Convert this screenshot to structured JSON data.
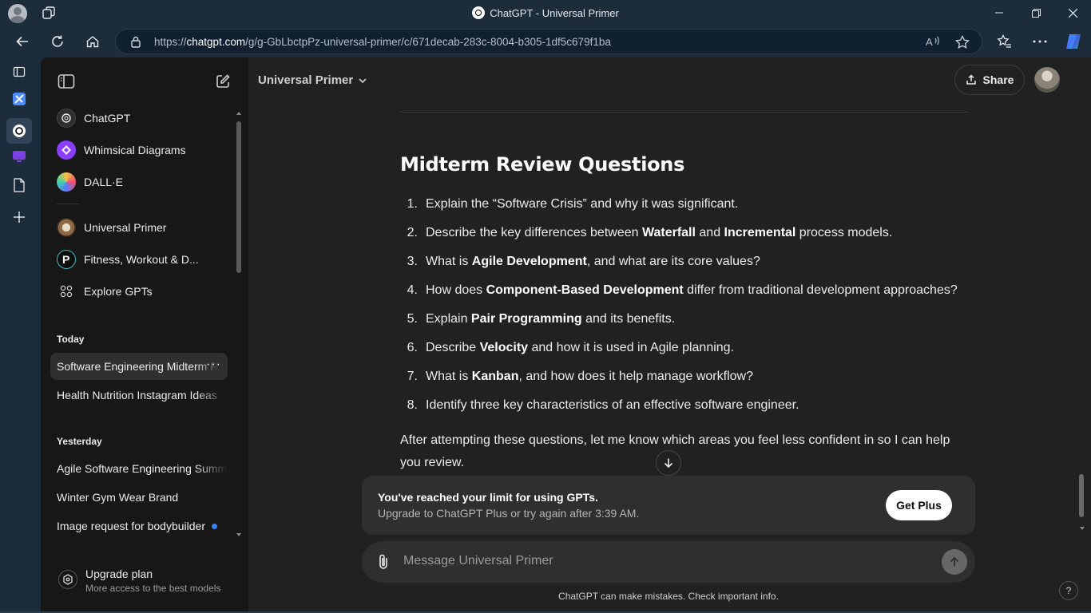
{
  "browser": {
    "window_title": "ChatGPT - Universal Primer",
    "url_prefix": "https://",
    "url_host": "chatgpt.com",
    "url_path": "/g/g-GbLbctpPz-universal-primer/c/671decab-283c-8004-b305-1df5c679f1ba",
    "read_aloud_label": "A⁾"
  },
  "sidebar": {
    "gpts": [
      {
        "label": "ChatGPT",
        "icon": "chatgpt-logo-icon"
      },
      {
        "label": "Whimsical Diagrams",
        "icon": "whimsical-icon"
      },
      {
        "label": "DALL·E",
        "icon": "dalle-icon"
      },
      {
        "label": "Universal Primer",
        "icon": "universal-primer-icon"
      },
      {
        "label": "Fitness, Workout & D...",
        "icon": "fitness-gpt-icon"
      },
      {
        "label": "Explore GPTs",
        "icon": "grid-icon"
      }
    ],
    "today_label": "Today",
    "today": [
      {
        "label": "Software Engineering Midterm Review"
      },
      {
        "label": "Health Nutrition Instagram Ideas"
      }
    ],
    "yesterday_label": "Yesterday",
    "yesterday": [
      {
        "label": "Agile Software Engineering Summary"
      },
      {
        "label": "Winter Gym Wear Brand"
      },
      {
        "label": "Image request for bodybuilder"
      }
    ],
    "more_label": "···",
    "upgrade_title": "Upgrade plan",
    "upgrade_subtitle": "More access to the best models"
  },
  "header": {
    "model_name": "Universal Primer",
    "share_label": "Share"
  },
  "content": {
    "heading": "Midterm Review Questions",
    "questions": [
      {
        "n": "1.",
        "html": "Explain the “Software Crisis” and why it was significant."
      },
      {
        "n": "2.",
        "html": "Describe the key differences between <b>Waterfall</b> and <b>Incremental</b> process models."
      },
      {
        "n": "3.",
        "html": "What is <b>Agile Development</b>, and what are its core values?"
      },
      {
        "n": "4.",
        "html": "How does <b>Component-Based Development</b> differ from traditional development approaches?"
      },
      {
        "n": "5.",
        "html": "Explain <b>Pair Programming</b> and its benefits."
      },
      {
        "n": "6.",
        "html": "Describe <b>Velocity</b> and how it is used in Agile planning."
      },
      {
        "n": "7.",
        "html": "What is <b>Kanban</b>, and how does it help manage workflow?"
      },
      {
        "n": "8.",
        "html": "Identify three key characteristics of an effective software engineer."
      }
    ],
    "outro": "After attempting these questions, let me know which areas you feel less confident in so I can help you review."
  },
  "limit": {
    "title": "You've reached your limit for using GPTs.",
    "subtitle": "Upgrade to ChatGPT Plus or try again after 3:39 AM.",
    "button": "Get Plus"
  },
  "composer": {
    "placeholder": "Message Universal Primer"
  },
  "footer": {
    "disclaimer": "ChatGPT can make mistakes. Check important info.",
    "help": "?"
  },
  "colors": {
    "app_bg": "#212121",
    "sidebar_bg": "#171717",
    "browser_chrome": "#1c2c3b",
    "accent_dot": "#3b82f6"
  }
}
